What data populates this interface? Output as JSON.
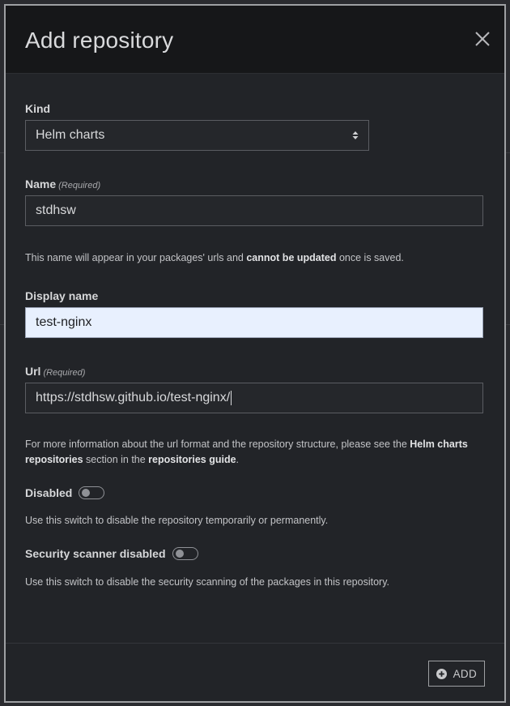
{
  "modal": {
    "title": "Add repository",
    "close_icon": "close-icon"
  },
  "form": {
    "kind": {
      "label": "Kind",
      "value": "Helm charts"
    },
    "name": {
      "label": "Name",
      "required": "(Required)",
      "value": "stdhsw",
      "help_prefix": "This name will appear in your packages' urls and ",
      "help_bold": "cannot be updated",
      "help_suffix": " once is saved."
    },
    "display_name": {
      "label": "Display name",
      "value": "test-nginx"
    },
    "url": {
      "label": "Url",
      "required": "(Required)",
      "value": "https://stdhsw.github.io/test-nginx/",
      "help_prefix": "For more information about the url format and the repository structure, please see the ",
      "help_bold1": "Helm charts repositories",
      "help_mid": " section in the ",
      "help_bold2": "repositories guide",
      "help_suffix": "."
    },
    "disabled": {
      "label": "Disabled",
      "checked": false,
      "help": "Use this switch to disable the repository temporarily or permanently."
    },
    "scanner_disabled": {
      "label": "Security scanner disabled",
      "checked": false,
      "help": "Use this switch to disable the security scanning of the packages in this repository."
    }
  },
  "footer": {
    "add_label": "ADD",
    "add_icon": "plus-circle-icon"
  },
  "colors": {
    "modal_bg": "#222428",
    "header_bg": "#161719",
    "autofill_bg": "#e8f0fe"
  }
}
